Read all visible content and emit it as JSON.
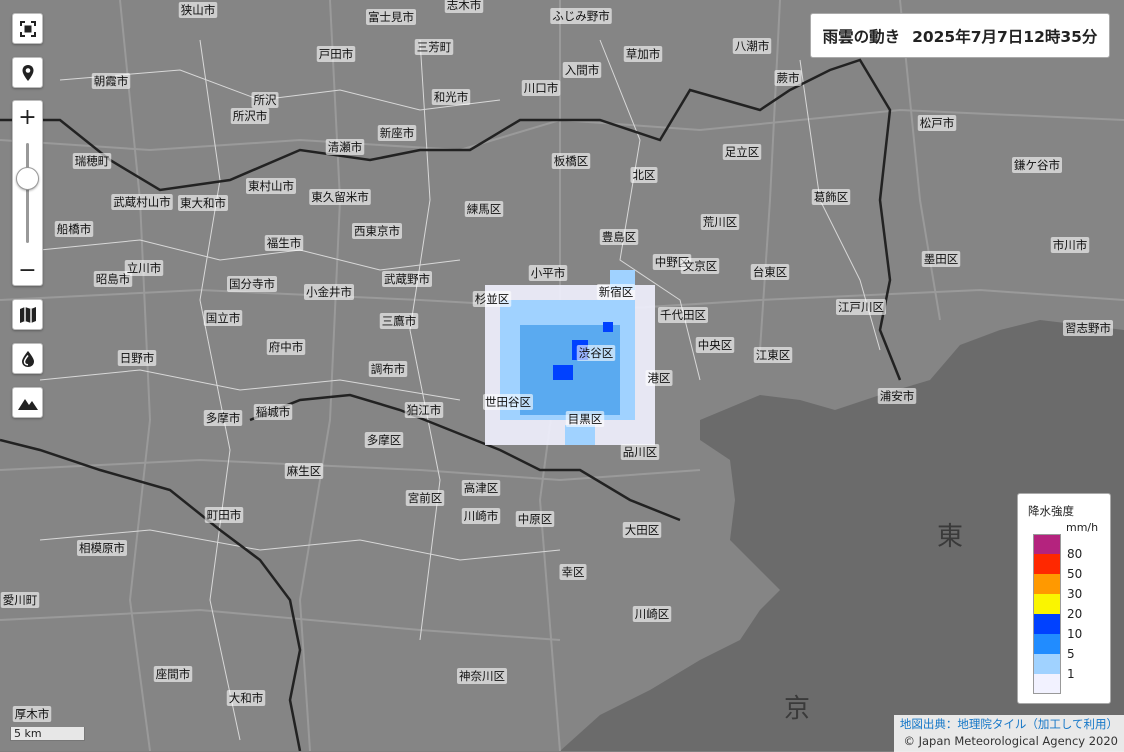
{
  "header": {
    "title": "雨雲の動き",
    "timestamp": "2025年7月7日12時35分"
  },
  "controls": {
    "fullscreen_icon": "fullscreen-icon",
    "location_icon": "location-pin-icon",
    "zoom_in_label": "+",
    "zoom_out_label": "−",
    "zoom_level_fraction": 0.35,
    "layer_buttons": [
      "map-icon",
      "rain-drop-icon",
      "mountain-icon"
    ]
  },
  "legend": {
    "title": "降水強度",
    "unit": "mm/h",
    "levels": [
      {
        "label": "80",
        "color": "#b4237e"
      },
      {
        "label": "50",
        "color": "#ff2800"
      },
      {
        "label": "30",
        "color": "#ff9900"
      },
      {
        "label": "20",
        "color": "#faf500"
      },
      {
        "label": "10",
        "color": "#0041ff"
      },
      {
        "label": "5",
        "color": "#218cff"
      },
      {
        "label": "1",
        "color": "#a0d2ff"
      },
      {
        "label": "",
        "color": "#f2f2ff"
      }
    ]
  },
  "scale_bar": {
    "label": "5 km"
  },
  "attribution": {
    "source": "地図出典：地理院タイル（加工して利用）",
    "copyright": "© Japan Meteorological Agency 2020"
  },
  "map_labels": [
    "狭山市",
    "富士見市",
    "ふじみ野市",
    "志木市",
    "三芳町",
    "戸田市",
    "川口市",
    "草加市",
    "八潮市",
    "蕨市",
    "入間市",
    "朝霞市",
    "和光市",
    "所沢",
    "所沢市",
    "新座市",
    "清瀬市",
    "板橋区",
    "北区",
    "足立区",
    "松戸市",
    "瑞穂町",
    "東村山市",
    "東久留米市",
    "練馬区",
    "葛飾区",
    "鎌ケ谷市",
    "武蔵村山市",
    "東大和市",
    "西東京市",
    "荒川区",
    "豊島区",
    "福生市",
    "小平市",
    "中野区",
    "文京区",
    "台東区",
    "墨田区",
    "市川市",
    "船橋市",
    "昭島市",
    "立川市",
    "国分寺市",
    "小金井市",
    "武蔵野市",
    "杉並区",
    "新宿区",
    "千代田区",
    "江戸川区",
    "習志野市",
    "国立市",
    "三鷹市",
    "渋谷区",
    "中央区",
    "江東区",
    "日野市",
    "府中市",
    "調布市",
    "港区",
    "浦安市",
    "世田谷区",
    "狛江市",
    "多摩市",
    "稲城市",
    "目黒区",
    "品川区",
    "麻生区",
    "多摩区",
    "高津区",
    "宮前区",
    "川崎市",
    "中原区",
    "町田市",
    "大田区",
    "相模原市",
    "幸区",
    "川崎区",
    "神奈川区",
    "座間市",
    "大和市",
    "厚木市",
    "愛川町",
    "東",
    "京"
  ]
}
